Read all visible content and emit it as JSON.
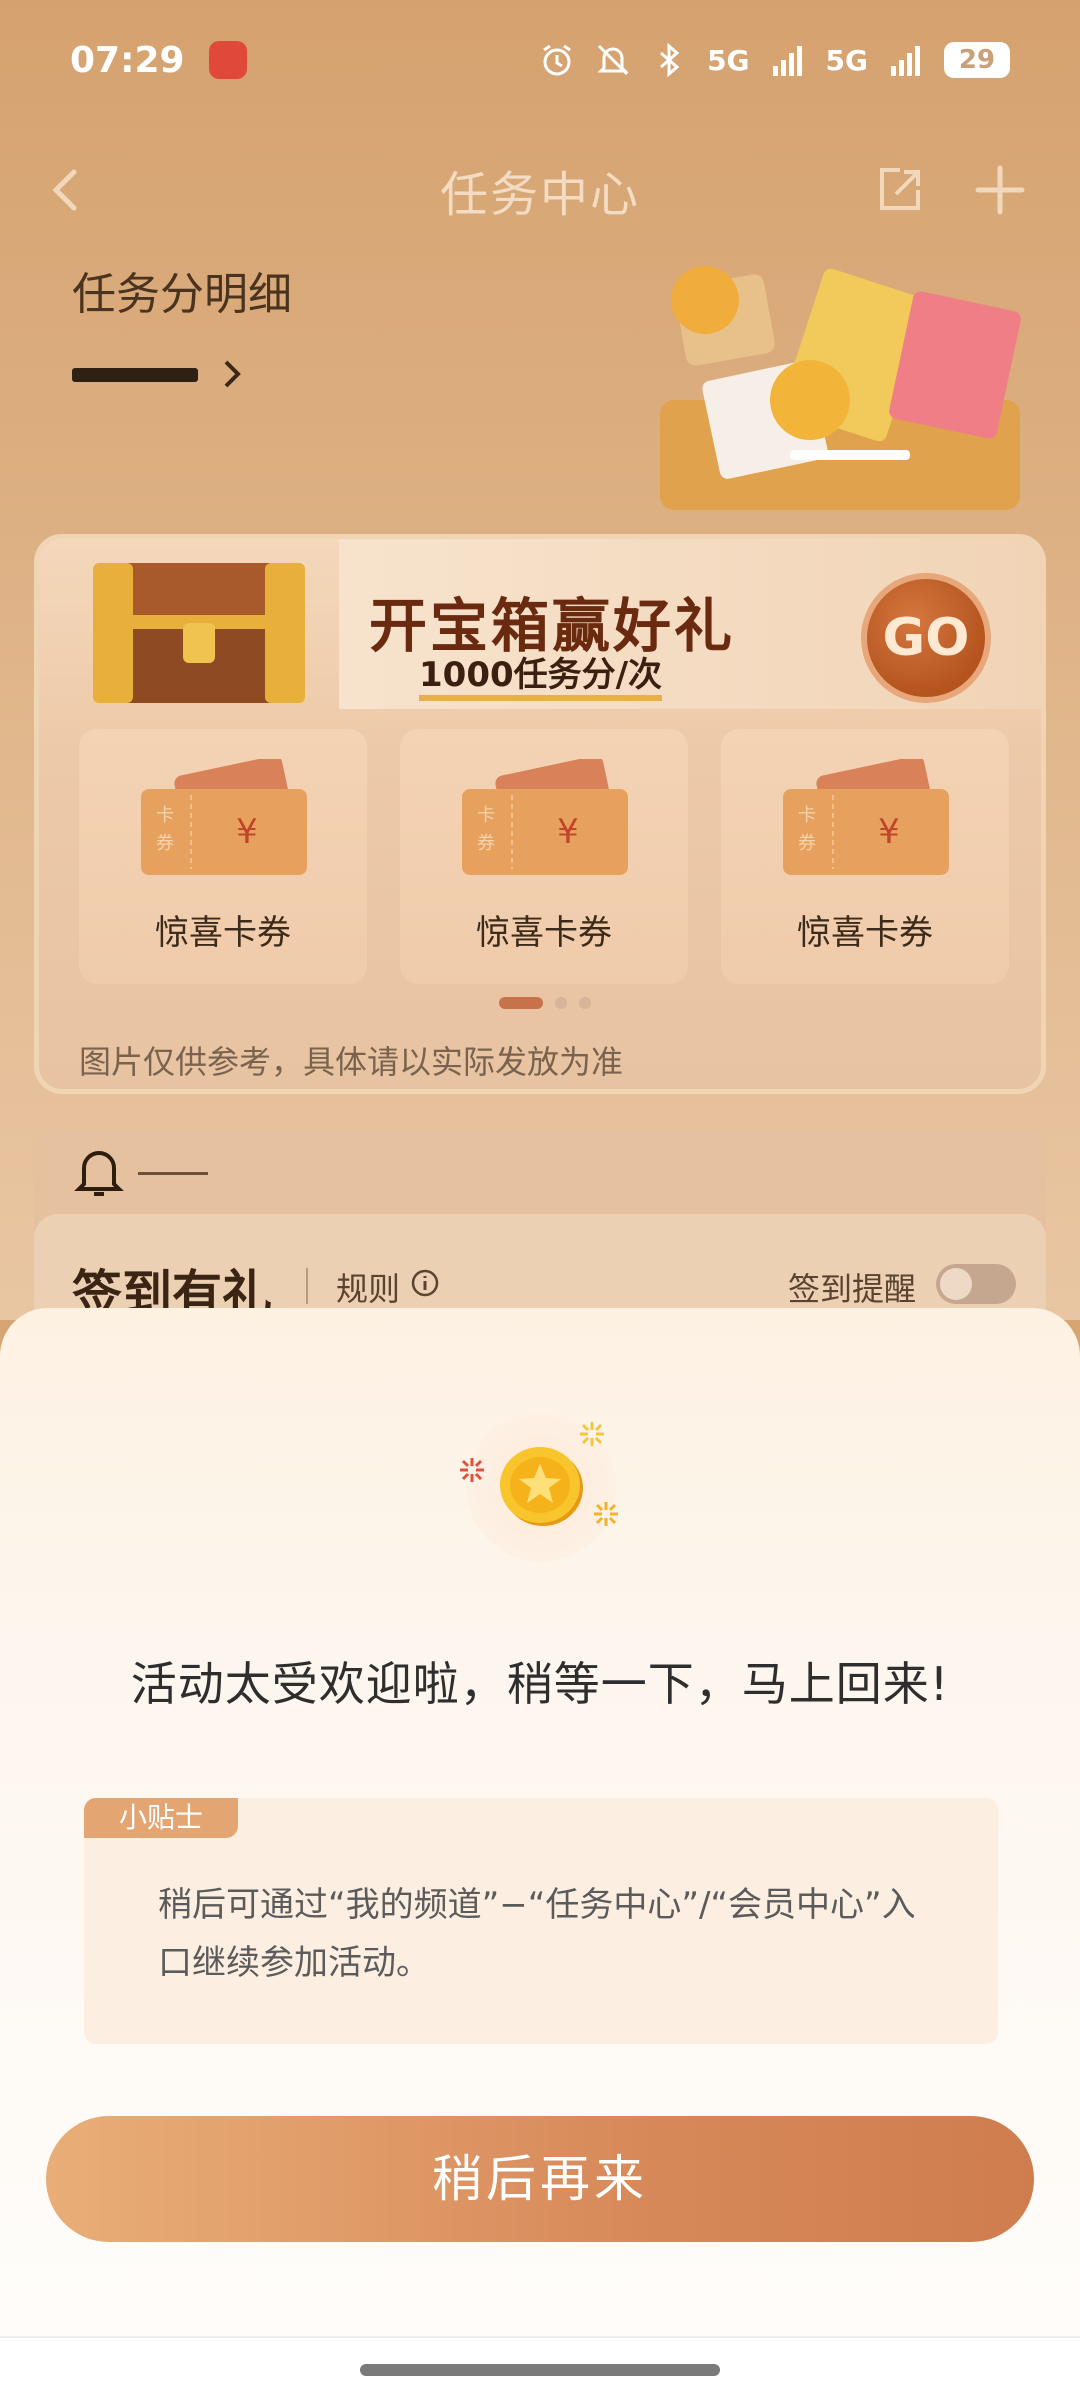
{
  "status_bar": {
    "time": "07:29",
    "network_1": "5G",
    "network_2": "5G",
    "battery": "29"
  },
  "nav": {
    "title": "任务中心"
  },
  "points": {
    "label": "任务分明细"
  },
  "treasure_card": {
    "title": "开宝箱赢好礼",
    "subtitle": "1000任务分/次",
    "go_label": "GO",
    "coupons": [
      {
        "label": "惊喜卡券",
        "tag": "卡券",
        "symbol": "¥"
      },
      {
        "label": "惊喜卡券",
        "tag": "卡券",
        "symbol": "¥"
      },
      {
        "label": "惊喜卡券",
        "tag": "卡券",
        "symbol": "¥"
      }
    ],
    "disclaimer": "图片仅供参考，具体请以实际发放为准"
  },
  "checkin": {
    "title": "签到有礼",
    "rule_label": "规则",
    "remind_label": "签到提醒"
  },
  "modal": {
    "title": "活动太受欢迎啦，稍等一下，马上回来!",
    "tip_tag": "小贴士",
    "tip_text": "稍后可通过“我的频道”−“任务中心”/“会员中心”入口继续参加活动。",
    "button_label": "稍后再来"
  },
  "colors": {
    "accent": "#d7895a",
    "tip_tag": "#e3a672",
    "background": "#d7a573"
  },
  "icons": [
    "alarm-icon",
    "mute-icon",
    "bluetooth-icon",
    "signal-icon",
    "back-icon",
    "share-icon",
    "add-icon",
    "chevron-right-icon",
    "bell-icon",
    "info-icon",
    "coin-icon"
  ]
}
